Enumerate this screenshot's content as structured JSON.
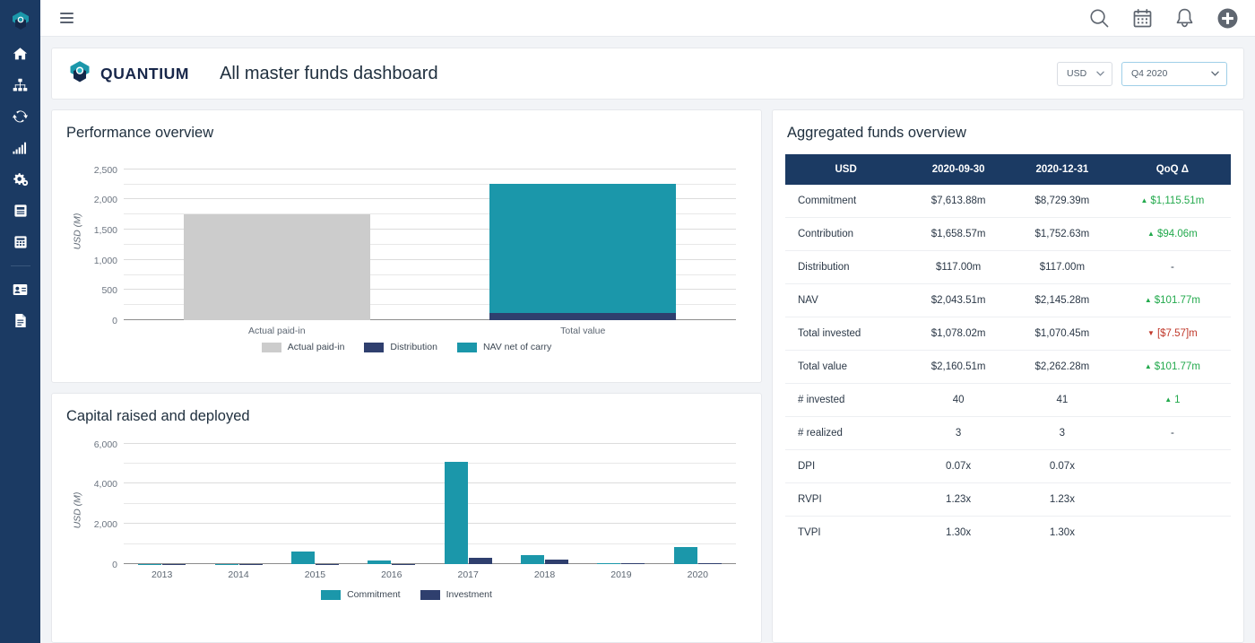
{
  "sidebar": {
    "logo": "quantium-logo-icon",
    "items": [
      {
        "name": "home-icon",
        "label": "Home"
      },
      {
        "name": "org-chart-icon",
        "label": "Structure"
      },
      {
        "name": "refresh-icon",
        "label": "Sync"
      },
      {
        "name": "bar-chart-icon",
        "label": "Analytics"
      },
      {
        "name": "settings-gears-icon",
        "label": "Settings"
      },
      {
        "name": "book-icon",
        "label": "Ledger"
      },
      {
        "name": "calculator-icon",
        "label": "Calculator"
      },
      {
        "name": "contact-card-icon",
        "label": "Contacts"
      },
      {
        "name": "document-icon",
        "label": "Documents"
      }
    ]
  },
  "topbar": {
    "menu_label": "Menu",
    "actions": [
      {
        "name": "search-icon",
        "label": "Search"
      },
      {
        "name": "calendar-icon",
        "label": "Calendar"
      },
      {
        "name": "bell-icon",
        "label": "Notifications"
      },
      {
        "name": "plus-circle-icon",
        "label": "Add"
      }
    ]
  },
  "header": {
    "brand": "QUANTIUM",
    "title": "All master funds dashboard",
    "currency": {
      "value": "USD",
      "caret": "⌄"
    },
    "period": {
      "value": "Q4 2020",
      "caret": "⌄"
    }
  },
  "colors": {
    "navy": "#1b3a63",
    "teal": "#1b97aa",
    "dark_blue": "#2f3f6e",
    "grey": "#cccccc",
    "up_green": "#22a94c",
    "down_red": "#c0392b"
  },
  "chart_data": [
    {
      "id": "performance-overview",
      "type": "bar",
      "title": "Performance overview",
      "stacked": true,
      "xlabel": "",
      "ylabel": "USD (M)",
      "ylim": [
        0,
        2750
      ],
      "yticks": [
        0,
        500,
        1000,
        1500,
        2000,
        2500
      ],
      "ytick_labels": [
        "0",
        "500",
        "1,000",
        "1,500",
        "2,000",
        "2,500"
      ],
      "minor_gridlines": true,
      "grid": true,
      "legend_position": "bottom",
      "categories": [
        "Actual paid-in",
        "Total value"
      ],
      "series": [
        {
          "name": "Actual paid-in",
          "color": "#cccccc",
          "values": [
            1752.63,
            0
          ]
        },
        {
          "name": "Distribution",
          "color": "#2f3f6e",
          "values": [
            0,
            117.0
          ]
        },
        {
          "name": "NAV net of carry",
          "color": "#1b97aa",
          "values": [
            0,
            2145.28
          ]
        }
      ]
    },
    {
      "id": "capital-raised-and-deployed",
      "type": "bar",
      "title": "Capital raised and deployed",
      "stacked": false,
      "xlabel": "",
      "ylabel": "USD (M)",
      "ylim": [
        0,
        6300
      ],
      "yticks": [
        0,
        2000,
        4000,
        6000
      ],
      "ytick_labels": [
        "0",
        "2,000",
        "4,000",
        "6,000"
      ],
      "minor_gridlines": true,
      "grid": true,
      "legend_position": "bottom",
      "categories": [
        "2013",
        "2014",
        "2015",
        "2016",
        "2017",
        "2018",
        "2019",
        "2020"
      ],
      "series": [
        {
          "name": "Commitment",
          "color": "#1b97aa",
          "values": [
            0,
            0,
            610,
            180,
            5100,
            430,
            60,
            830
          ]
        },
        {
          "name": "Investment",
          "color": "#2f3f6e",
          "values": [
            0,
            0,
            0,
            0,
            330,
            230,
            45,
            30
          ]
        }
      ]
    }
  ],
  "table": {
    "title": "Aggregated funds overview",
    "columns": [
      "USD",
      "2020-09-30",
      "2020-12-31",
      "QoQ Δ"
    ],
    "rows": [
      {
        "label": "Commitment",
        "prev": "$7,613.88m",
        "curr": "$8,729.39m",
        "delta": "$1,115.51m",
        "dir": "up"
      },
      {
        "label": "Contribution",
        "prev": "$1,658.57m",
        "curr": "$1,752.63m",
        "delta": "$94.06m",
        "dir": "up"
      },
      {
        "label": "Distribution",
        "prev": "$117.00m",
        "curr": "$117.00m",
        "delta": "-",
        "dir": "flat"
      },
      {
        "label": "NAV",
        "prev": "$2,043.51m",
        "curr": "$2,145.28m",
        "delta": "$101.77m",
        "dir": "up"
      },
      {
        "label": "Total invested",
        "prev": "$1,078.02m",
        "curr": "$1,070.45m",
        "delta": "[$7.57]m",
        "dir": "down"
      },
      {
        "label": "Total value",
        "prev": "$2,160.51m",
        "curr": "$2,262.28m",
        "delta": "$101.77m",
        "dir": "up"
      },
      {
        "label": "# invested",
        "prev": "40",
        "curr": "41",
        "delta": "1",
        "dir": "up"
      },
      {
        "label": "# realized",
        "prev": "3",
        "curr": "3",
        "delta": "-",
        "dir": "flat"
      },
      {
        "label": "DPI",
        "prev": "0.07x",
        "curr": "0.07x",
        "delta": "",
        "dir": "none"
      },
      {
        "label": "RVPI",
        "prev": "1.23x",
        "curr": "1.23x",
        "delta": "",
        "dir": "none"
      },
      {
        "label": "TVPI",
        "prev": "1.30x",
        "curr": "1.30x",
        "delta": "",
        "dir": "none"
      }
    ]
  }
}
